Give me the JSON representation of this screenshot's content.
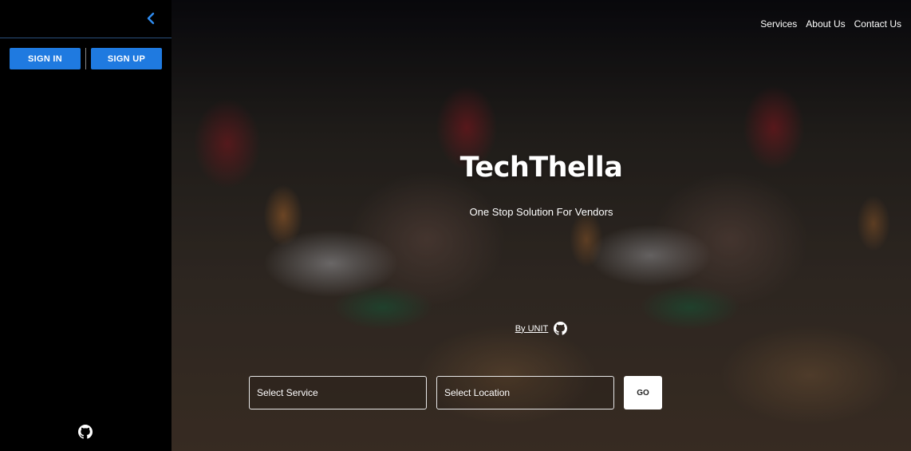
{
  "sidebar": {
    "collapse_icon": "chevron-left-icon",
    "sign_in_label": "SIGN IN",
    "sign_up_label": "SIGN UP",
    "footer_icon": "github-icon"
  },
  "nav": {
    "items": [
      {
        "label": "Services"
      },
      {
        "label": "About Us"
      },
      {
        "label": "Contact Us"
      }
    ]
  },
  "hero": {
    "title": "TechThella",
    "subtitle": "One Stop Solution For Vendors",
    "byline": "By UNIT",
    "byline_icon": "github-icon"
  },
  "search": {
    "service_placeholder": "Select Service",
    "location_placeholder": "Select Location",
    "go_label": "GO"
  },
  "colors": {
    "accent": "#1f7ae0",
    "sidebar_bg": "#000000",
    "divider": "#2a4f7a"
  }
}
